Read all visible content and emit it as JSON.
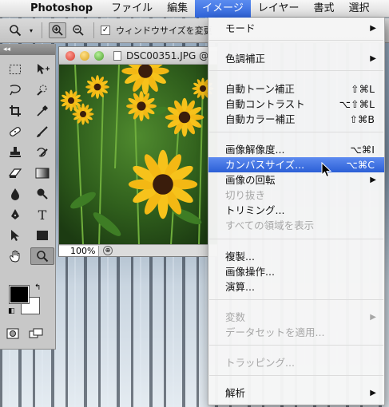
{
  "menubar": {
    "app_name": "Photoshop",
    "items": [
      "ファイル",
      "編集",
      "イメージ",
      "レイヤー",
      "書式",
      "選択"
    ]
  },
  "options_bar": {
    "checkbox_label": "ウィンドウサイズを変更"
  },
  "document": {
    "title": "DSC00351.JPG @",
    "zoom": "100%"
  },
  "image_menu": {
    "items": [
      {
        "label": "モード",
        "shortcut": "",
        "submenu": true,
        "enabled": true
      },
      {
        "label": "色調補正",
        "shortcut": "",
        "submenu": true,
        "enabled": true
      },
      {
        "label": "自動トーン補正",
        "shortcut": "⇧⌘L",
        "submenu": false,
        "enabled": true
      },
      {
        "label": "自動コントラスト",
        "shortcut": "⌥⇧⌘L",
        "submenu": false,
        "enabled": true
      },
      {
        "label": "自動カラー補正",
        "shortcut": "⇧⌘B",
        "submenu": false,
        "enabled": true
      },
      {
        "label": "画像解像度...",
        "shortcut": "⌥⌘I",
        "submenu": false,
        "enabled": true
      },
      {
        "label": "カンバスサイズ...",
        "shortcut": "⌥⌘C",
        "submenu": false,
        "enabled": true,
        "highlighted": true
      },
      {
        "label": "画像の回転",
        "shortcut": "",
        "submenu": true,
        "enabled": true
      },
      {
        "label": "切り抜き",
        "shortcut": "",
        "submenu": false,
        "enabled": false
      },
      {
        "label": "トリミング...",
        "shortcut": "",
        "submenu": false,
        "enabled": true
      },
      {
        "label": "すべての領域を表示",
        "shortcut": "",
        "submenu": false,
        "enabled": false
      },
      {
        "label": "複製...",
        "shortcut": "",
        "submenu": false,
        "enabled": true
      },
      {
        "label": "画像操作...",
        "shortcut": "",
        "submenu": false,
        "enabled": true
      },
      {
        "label": "演算...",
        "shortcut": "",
        "submenu": false,
        "enabled": true
      },
      {
        "label": "変数",
        "shortcut": "",
        "submenu": true,
        "enabled": false
      },
      {
        "label": "データセットを適用...",
        "shortcut": "",
        "submenu": false,
        "enabled": false
      },
      {
        "label": "トラッピング...",
        "shortcut": "",
        "submenu": false,
        "enabled": false
      },
      {
        "label": "解析",
        "shortcut": "",
        "submenu": true,
        "enabled": true
      }
    ]
  },
  "icons": {
    "apple": "apple-icon",
    "zoom_tool": "zoom-tool-icon",
    "zoom_in": "zoom-in-icon",
    "zoom_out": "zoom-out-icon",
    "submenu_arrow": "triangle-right-icon"
  },
  "colors": {
    "menu_highlight": "#2f63d8",
    "foreground": "#000000",
    "background": "#ffffff"
  }
}
